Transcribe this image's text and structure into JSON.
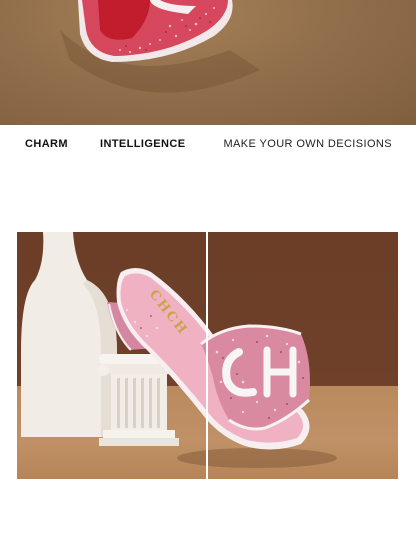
{
  "hero": {
    "image_label": "sandal-top-crop",
    "brand_mark": "CH"
  },
  "taglines": {
    "left": "CHARM",
    "middle": "INTELLIGENCE",
    "right": "MAKE YOUR OWN DECISIONS"
  },
  "product_photo": {
    "insole_logo": "CHCH",
    "strap_logo": "CH",
    "colors": {
      "wall": "#6b3e28",
      "floor": "#bd8d61",
      "tweed_pink": "#d98aa0",
      "insole_pink": "#f1b3c3",
      "vase": "#f2ede6"
    }
  }
}
